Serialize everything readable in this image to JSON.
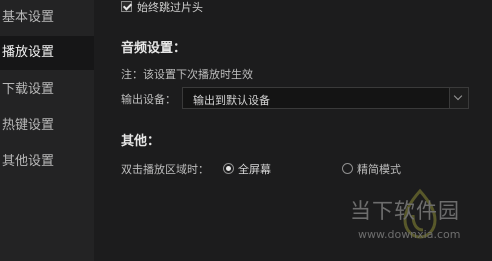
{
  "sidebar": {
    "items": [
      {
        "label": "基本设置"
      },
      {
        "label": "播放设置"
      },
      {
        "label": "下载设置"
      },
      {
        "label": "热键设置"
      },
      {
        "label": "其他设置"
      }
    ]
  },
  "main": {
    "skip_intro_label": "始终跳过片头",
    "skip_intro_checked": true,
    "audio": {
      "heading": "音频设置：",
      "note": "注：该设置下次播放时生效",
      "output_label": "输出设备：",
      "output_value": "输出到默认设备"
    },
    "other": {
      "heading": "其他：",
      "doubleclick_label": "双击播放区域时：",
      "options": [
        {
          "label": "全屏幕",
          "checked": true
        },
        {
          "label": "精简模式",
          "checked": false
        }
      ]
    }
  },
  "watermark": {
    "title": "当下软件园",
    "url": "www.downxia.com"
  }
}
